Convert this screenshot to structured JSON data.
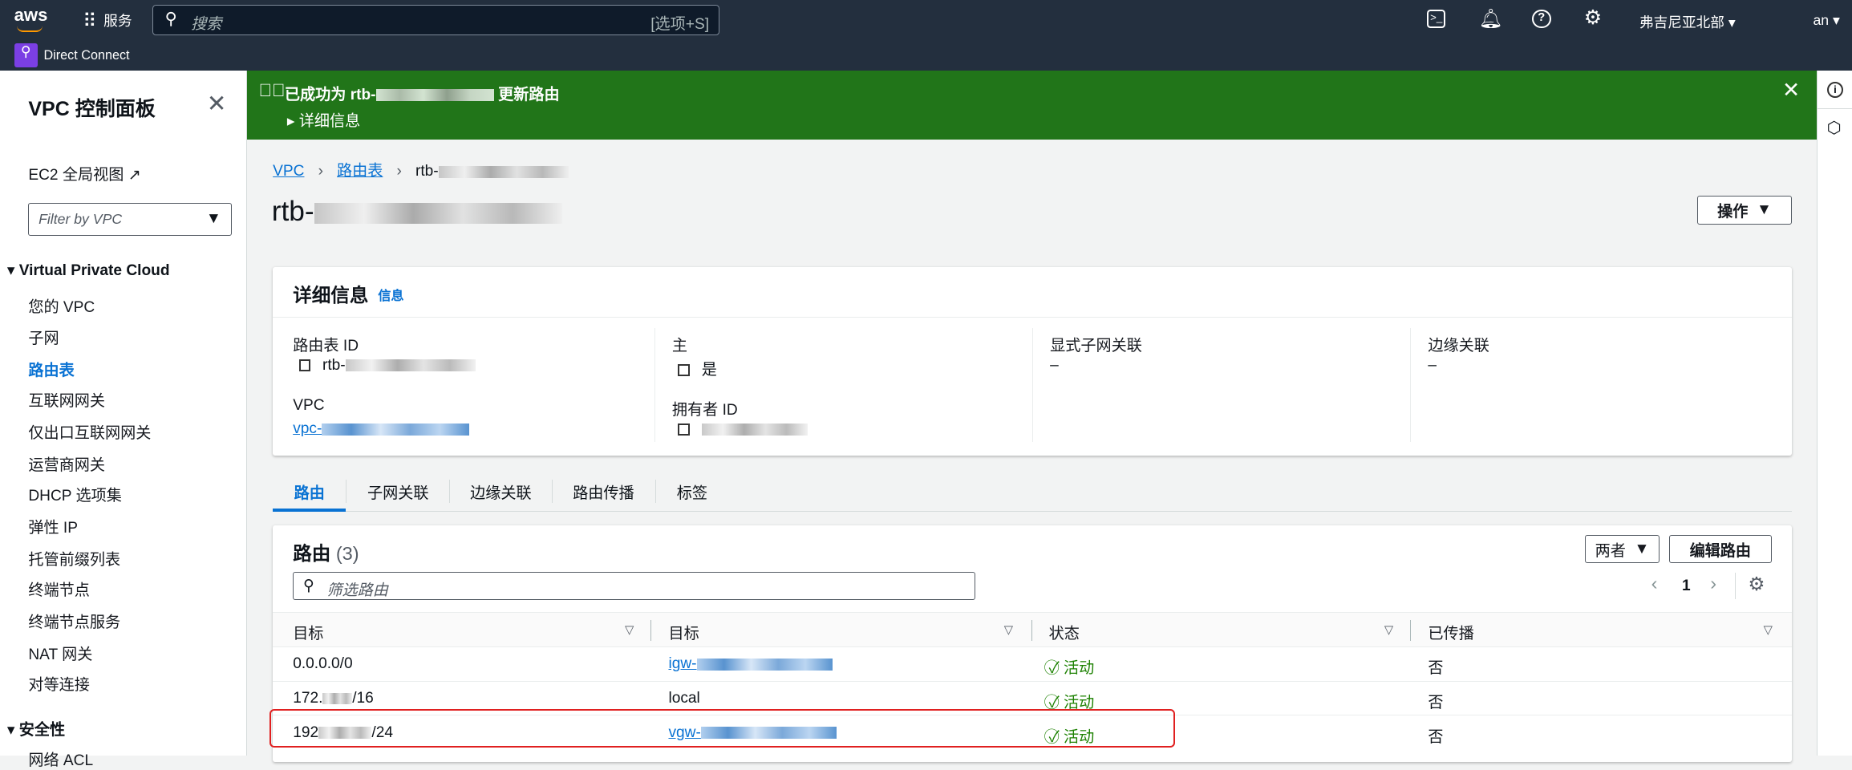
{
  "topbar": {
    "logo": "aws",
    "services": "服务",
    "search_placeholder": "搜索",
    "shortcut": "[选项+S]",
    "region": "弗吉尼亚北部",
    "account": "an",
    "service_pin": "Direct Connect"
  },
  "flash": {
    "prefix": "已成功为 rtb-",
    "suffix": "更新路由",
    "details": "详细信息"
  },
  "sidebar": {
    "title": "VPC 控制面板",
    "ec2": "EC2 全局视图",
    "filter_placeholder": "Filter by VPC",
    "section": "Virtual Private Cloud",
    "items": [
      "您的 VPC",
      "子网",
      "路由表",
      "互联网网关",
      "仅出口互联网网关",
      "运营商网关",
      "DHCP 选项集",
      "弹性 IP",
      "托管前缀列表",
      "终端节点",
      "终端节点服务",
      "NAT 网关",
      "对等连接"
    ],
    "section2": "安全性",
    "cut": "网络 ACL"
  },
  "breadcrumb": {
    "vpc": "VPC",
    "rt": "路由表",
    "current": "rtb-"
  },
  "page": {
    "title": "rtb-",
    "actions": "操作"
  },
  "details": {
    "title": "详细信息",
    "info": "信息",
    "rt_id_label": "路由表 ID",
    "rt_id": "rtb-",
    "main_label": "主",
    "main_value": "是",
    "explicit_label": "显式子网关联",
    "explicit_value": "–",
    "edge_label": "边缘关联",
    "edge_value": "–",
    "vpc_label": "VPC",
    "vpc_value": "vpc-",
    "owner_label": "拥有者 ID"
  },
  "tabs": [
    "路由",
    "子网关联",
    "边缘关联",
    "路由传播",
    "标签"
  ],
  "routes": {
    "title": "路由",
    "count": "(3)",
    "filter_select": "两者",
    "edit": "编辑路由",
    "filter_placeholder": "筛选路由",
    "page": "1",
    "headers": [
      "目标",
      "目标",
      "状态",
      "已传播"
    ],
    "rows": [
      {
        "dest": "0.0.0.0/0",
        "target": "igw-",
        "status": "活动",
        "propagated": "否",
        "dest_mask": false,
        "link": true
      },
      {
        "dest": "172.",
        "dest_tail": "/16",
        "target": "local",
        "status": "活动",
        "propagated": "否",
        "link": false
      },
      {
        "dest": "192",
        "dest_tail": "/24",
        "target": "vgw-",
        "status": "活动",
        "propagated": "否",
        "link": true
      }
    ]
  },
  "colors": {
    "topbar": "#232f3e",
    "success": "#217519",
    "link": "#0972d3",
    "highlight": "#e02020"
  }
}
